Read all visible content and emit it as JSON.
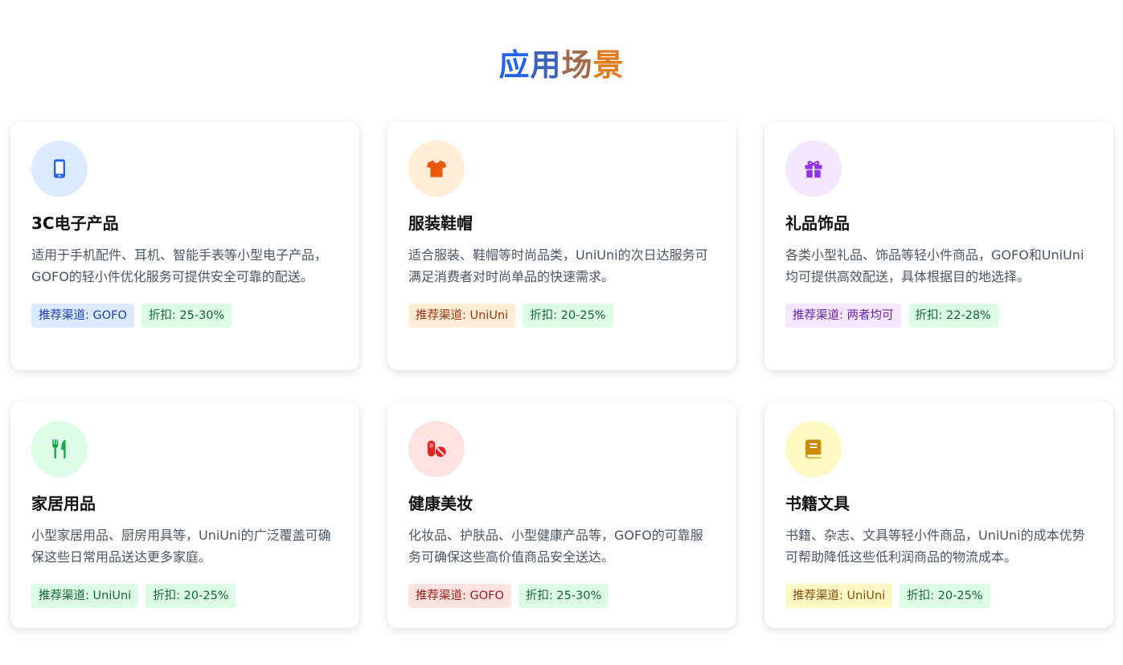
{
  "page": {
    "title_chars": [
      "应",
      "用",
      "场",
      "景"
    ],
    "title_colors": [
      "#2563eb",
      "#3f63b8",
      "#a06a4e",
      "#e07a1f"
    ]
  },
  "cards": [
    {
      "icon": "smartphone-icon",
      "icon_color": "#2563eb",
      "icon_bg": "#dbeafe",
      "title": "3C电子产品",
      "desc": "适用于手机配件、耳机、智能手表等小型电子产品，GOFO的轻小件优化服务可提供安全可靠的配送。",
      "channel": "推荐渠道: GOFO",
      "channel_bg": "#dbeafe",
      "channel_color": "#1e40af",
      "discount": "折扣: 25-30%"
    },
    {
      "icon": "tshirt-icon",
      "icon_color": "#ea580c",
      "icon_bg": "#ffedd5",
      "title": "服装鞋帽",
      "desc": "适合服装、鞋帽等时尚品类，UniUni的次日达服务可满足消费者对时尚单品的快速需求。",
      "channel": "推荐渠道: UniUni",
      "channel_bg": "#ffedd5",
      "channel_color": "#9a3412",
      "discount": "折扣: 20-25%"
    },
    {
      "icon": "gift-icon",
      "icon_color": "#9333ea",
      "icon_bg": "#f3e8ff",
      "title": "礼品饰品",
      "desc": "各类小型礼品、饰品等轻小件商品，GOFO和UniUni均可提供高效配送，具体根据目的地选择。",
      "channel": "推荐渠道: 两者均可",
      "channel_bg": "#f3e8ff",
      "channel_color": "#6b21a8",
      "discount": "折扣: 22-28%"
    },
    {
      "icon": "utensils-icon",
      "icon_color": "#16a34a",
      "icon_bg": "#dcfce7",
      "title": "家居用品",
      "desc": "小型家居用品、厨房用具等，UniUni的广泛覆盖可确保这些日常用品送达更多家庭。",
      "channel": "推荐渠道: UniUni",
      "channel_bg": "#dcfce7",
      "channel_color": "#166534",
      "discount": "折扣: 20-25%"
    },
    {
      "icon": "pills-icon",
      "icon_color": "#dc2626",
      "icon_bg": "#fee2e2",
      "title": "健康美妆",
      "desc": "化妆品、护肤品、小型健康产品等，GOFO的可靠服务可确保这些高价值商品安全送达。",
      "channel": "推荐渠道: GOFO",
      "channel_bg": "#fee2e2",
      "channel_color": "#991b1b",
      "discount": "折扣: 25-30%"
    },
    {
      "icon": "book-icon",
      "icon_color": "#ca8a04",
      "icon_bg": "#fef9c3",
      "title": "书籍文具",
      "desc": "书籍、杂志、文具等轻小件商品，UniUni的成本优势可帮助降低这些低利润商品的物流成本。",
      "channel": "推荐渠道: UniUni",
      "channel_bg": "#fef9c3",
      "channel_color": "#854d0e",
      "discount": "折扣: 20-25%"
    }
  ],
  "discount_style": {
    "bg": "#dcfce7",
    "color": "#166534"
  }
}
